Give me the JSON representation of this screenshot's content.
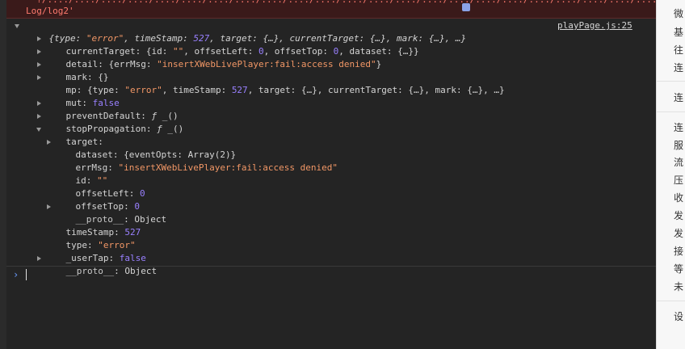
{
  "error_banner": {
    "line1": "  ?/..../..../..../..../..../..../..../..../..../..../..../..../..../..../..../..../..../..../..../..../..../..../..../..../.../..../",
    "line2": "Log/log2'"
  },
  "summary": {
    "open": "{",
    "type_key": "type",
    "type_val": "\"error\"",
    "ts_key": "timeStamp",
    "ts_val": "527",
    "rest": ", target: {…}, currentTarget: {…}, mark: {…}, …}",
    "source_link": "playPage.js:25"
  },
  "rows": {
    "currentTarget": {
      "key": "currentTarget",
      "a": "{id: ",
      "id_val": "\"\"",
      "b": ", offsetLeft: ",
      "ol_val": "0",
      "c": ", offsetTop: ",
      "ot_val": "0",
      "d": ", dataset: {…}}"
    },
    "detail": {
      "key": "detail",
      "a": "{errMsg: ",
      "val": "\"insertXWebLivePlayer:fail:access denied\"",
      "b": "}"
    },
    "mark": {
      "key": "mark",
      "val": "{}"
    },
    "mp": {
      "key": "mp",
      "a": "{type: ",
      "type_val": "\"error\"",
      "b": ", timeStamp: ",
      "ts_val": "527",
      "c": ", target: {…}, currentTarget: {…}, mark: {…}, …}"
    },
    "mut": {
      "key": "mut",
      "val": "false"
    },
    "preventDefault": {
      "key": "preventDefault",
      "f": "ƒ",
      "val": " _()"
    },
    "stopPropagation": {
      "key": "stopPropagation",
      "f": "ƒ",
      "val": " _()"
    },
    "target": {
      "key": "target"
    },
    "t_dataset": {
      "key": "dataset",
      "val": "{eventOpts: Array(2)}"
    },
    "t_errMsg": {
      "key": "errMsg",
      "val": "\"insertXWebLivePlayer:fail:access denied\""
    },
    "t_id": {
      "key": "id",
      "val": "\"\""
    },
    "t_offsetLeft": {
      "key": "offsetLeft",
      "val": "0"
    },
    "t_offsetTop": {
      "key": "offsetTop",
      "val": "0"
    },
    "t_proto": {
      "key": "__proto__",
      "val": "Object"
    },
    "timeStamp": {
      "key": "timeStamp",
      "val": "527"
    },
    "type": {
      "key": "type",
      "val": "\"error\""
    },
    "userTap": {
      "key": "_userTap",
      "val": "false"
    },
    "proto": {
      "key": "__proto__",
      "val": "Object"
    }
  },
  "prompt": {
    "symbol": "›"
  },
  "right_panel": {
    "items": [
      "微",
      "基",
      "往",
      "连",
      "连",
      "连",
      "服",
      "流",
      "压",
      "收",
      "发",
      "发",
      "接",
      "等",
      "未",
      "设"
    ]
  },
  "colors": {
    "background": "#242424",
    "string": "#f29766",
    "number": "#9980ff",
    "error_text": "#ff7a6e",
    "prompt": "#6a9cff"
  }
}
